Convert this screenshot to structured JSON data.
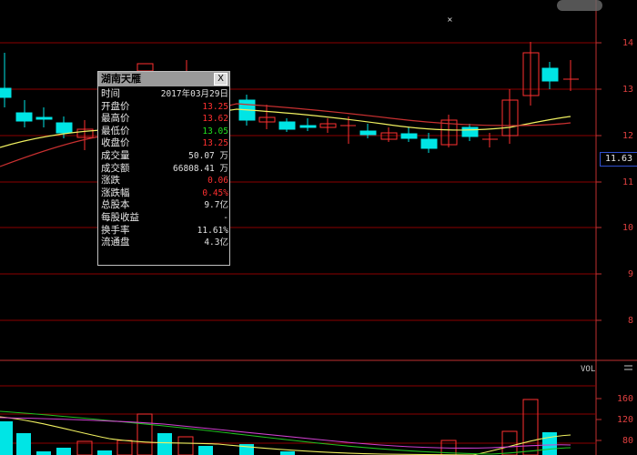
{
  "colors": {
    "up": "#ff3030",
    "down": "#00e5e5",
    "grid": "#8b0000",
    "ma_short": "#f0f060",
    "ma_long": "#c83030",
    "vma_1": "#f0f060",
    "vma_2": "#20c020",
    "vma_3": "#d040d0"
  },
  "price_axis": {
    "ticks": [
      "14",
      "13",
      "12",
      "11",
      "10",
      "9",
      "8"
    ],
    "current_price": "11.63"
  },
  "volume_panel": {
    "label": "VOL",
    "ticks": [
      "160",
      "120",
      "80"
    ]
  },
  "info_popup": {
    "title": "湖南天雁",
    "close_icon": "X",
    "rows": [
      {
        "label": "时间",
        "value": "2017年03月29日",
        "color": "white"
      },
      {
        "label": "开盘价",
        "value": "13.25",
        "color": "red"
      },
      {
        "label": "最高价",
        "value": "13.62",
        "color": "red"
      },
      {
        "label": "最低价",
        "value": "13.05",
        "color": "green"
      },
      {
        "label": "收盘价",
        "value": "13.25",
        "color": "red"
      },
      {
        "label": "成交量",
        "value": "50.07 万",
        "color": "white"
      },
      {
        "label": "成交额",
        "value": "66808.41 万",
        "color": "white"
      },
      {
        "label": "涨跌",
        "value": "0.06",
        "color": "red"
      },
      {
        "label": "涨跌幅",
        "value": "0.45%",
        "color": "red"
      },
      {
        "label": "总股本",
        "value": "9.7亿",
        "color": "white"
      },
      {
        "label": "每股收益",
        "value": "-",
        "color": "white"
      },
      {
        "label": "换手率",
        "value": "11.61%",
        "color": "white"
      },
      {
        "label": "流通盘",
        "value": "4.3亿",
        "color": "white"
      }
    ]
  }
}
